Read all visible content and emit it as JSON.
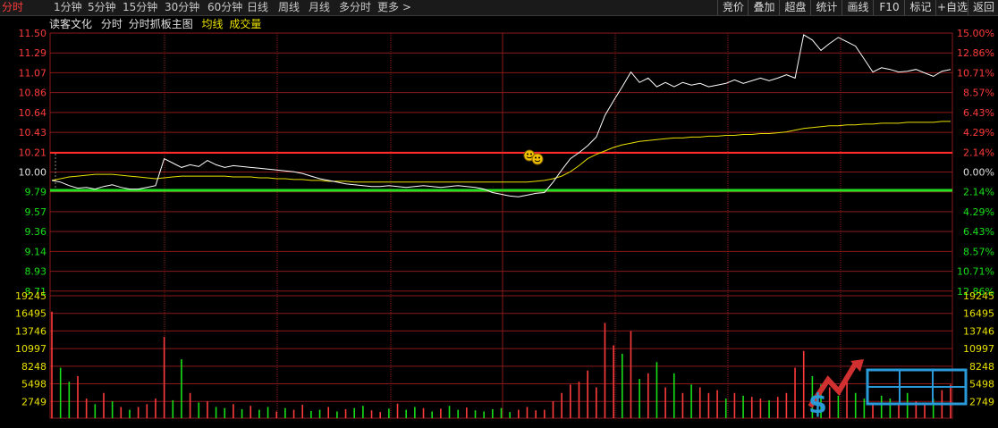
{
  "nav": {
    "tabs": [
      "分时",
      "1分钟",
      "5分钟",
      "15分钟",
      "30分钟",
      "60分钟",
      "日线",
      "周线",
      "月线",
      "多分时",
      "更多 >"
    ],
    "active_index": 0
  },
  "toolbar": [
    "竞价",
    "叠加",
    "超盘",
    "统计",
    "画线",
    "F10",
    "标记",
    "+自选",
    "返回"
  ],
  "info": {
    "stock_name": "读客文化",
    "view_mode": "分时",
    "board_label": "分时抓板主图",
    "avg_label": "均线",
    "volume_label": "成交量"
  },
  "colors": {
    "up": "#ff3b3b",
    "down": "#18e018",
    "flat": "#e0e0e0",
    "grid": "#8a1a1a",
    "price_line": "#ffffff",
    "avg_line": "#e8e000",
    "top_band": "#ff2a2a",
    "bottom_band": "#22e022"
  },
  "chart_data": {
    "type": "line",
    "prev_close": 10.0,
    "price_labels_left": [
      "11.50",
      "11.29",
      "11.07",
      "10.86",
      "10.64",
      "10.43",
      "10.21",
      "10.00",
      "9.79",
      "9.57",
      "9.36",
      "9.14",
      "8.93",
      "8.71"
    ],
    "pct_labels_right": [
      "15.00%",
      "12.86%",
      "10.71%",
      "8.57%",
      "6.43%",
      "4.29%",
      "2.14%",
      "0.00%",
      "2.14%",
      "4.29%",
      "6.43%",
      "8.57%",
      "10.71%",
      "12.86%"
    ],
    "ylim": [
      8.5,
      11.5
    ],
    "volume_labels": [
      "19245",
      "16495",
      "13746",
      "10997",
      "8248",
      "5498",
      "2749"
    ],
    "volume_max": 21995,
    "price_series": [
      9.8,
      9.78,
      9.74,
      9.71,
      9.72,
      9.7,
      9.73,
      9.75,
      9.72,
      9.7,
      9.7,
      9.72,
      9.74,
      10.05,
      10.0,
      9.95,
      9.98,
      9.96,
      10.03,
      9.98,
      9.95,
      9.97,
      9.96,
      9.95,
      9.94,
      9.93,
      9.92,
      9.91,
      9.9,
      9.88,
      9.85,
      9.82,
      9.8,
      9.78,
      9.76,
      9.75,
      9.74,
      9.73,
      9.73,
      9.74,
      9.73,
      9.72,
      9.73,
      9.74,
      9.73,
      9.72,
      9.73,
      9.74,
      9.73,
      9.72,
      9.7,
      9.66,
      9.64,
      9.62,
      9.61,
      9.63,
      9.65,
      9.66,
      9.78,
      9.92,
      10.05,
      10.12,
      10.2,
      10.3,
      10.55,
      10.72,
      10.88,
      11.05,
      10.93,
      10.98,
      10.88,
      10.93,
      10.88,
      10.93,
      10.9,
      10.92,
      10.88,
      10.9,
      10.92,
      10.96,
      10.92,
      10.95,
      10.98,
      10.95,
      10.98,
      11.02,
      10.98,
      11.48,
      11.42,
      11.3,
      11.38,
      11.45,
      11.4,
      11.35,
      11.2,
      11.05,
      11.1,
      11.08,
      11.05,
      11.06,
      11.08,
      11.04,
      11.0,
      11.06,
      11.08
    ],
    "avg_series": [
      9.8,
      9.82,
      9.84,
      9.85,
      9.86,
      9.87,
      9.87,
      9.87,
      9.86,
      9.85,
      9.84,
      9.83,
      9.82,
      9.83,
      9.84,
      9.85,
      9.85,
      9.85,
      9.85,
      9.85,
      9.85,
      9.84,
      9.84,
      9.84,
      9.83,
      9.83,
      9.82,
      9.82,
      9.81,
      9.81,
      9.8,
      9.8,
      9.79,
      9.79,
      9.79,
      9.78,
      9.78,
      9.78,
      9.78,
      9.78,
      9.78,
      9.78,
      9.78,
      9.78,
      9.78,
      9.78,
      9.78,
      9.78,
      9.78,
      9.78,
      9.78,
      9.78,
      9.78,
      9.78,
      9.78,
      9.78,
      9.79,
      9.8,
      9.82,
      9.85,
      9.9,
      9.97,
      10.05,
      10.1,
      10.14,
      10.18,
      10.21,
      10.23,
      10.25,
      10.26,
      10.27,
      10.28,
      10.29,
      10.29,
      10.3,
      10.3,
      10.31,
      10.31,
      10.32,
      10.32,
      10.33,
      10.33,
      10.34,
      10.34,
      10.35,
      10.36,
      10.38,
      10.4,
      10.41,
      10.42,
      10.43,
      10.43,
      10.44,
      10.44,
      10.45,
      10.45,
      10.46,
      10.46,
      10.46,
      10.47,
      10.47,
      10.47,
      10.47,
      10.48,
      10.48
    ],
    "volume_series": [
      19000,
      9000,
      6500,
      7500,
      3500,
      2500,
      4500,
      3000,
      2000,
      1500,
      2000,
      2500,
      3500,
      14500,
      3200,
      10500,
      4500,
      2800,
      3000,
      2000,
      1800,
      2500,
      1600,
      2200,
      1500,
      2000,
      1200,
      1800,
      1500,
      2400,
      1300,
      1500,
      2000,
      1200,
      1600,
      1800,
      2200,
      1400,
      1100,
      1700,
      2600,
      1500,
      2000,
      1800,
      1200,
      1700,
      2200,
      1500,
      1900,
      1400,
      1200,
      1600,
      1800,
      1100,
      1500,
      2000,
      1400,
      1500,
      3000,
      4500,
      6000,
      6500,
      8500,
      5500,
      17000,
      13000,
      11500,
      15500,
      7000,
      8000,
      10000,
      5500,
      8000,
      4500,
      6000,
      5500,
      4500,
      5000,
      3500,
      4500,
      4000,
      3800,
      3500,
      3200,
      3800,
      4500,
      9000,
      12000,
      7500,
      6000,
      5500,
      4000,
      7000,
      4500,
      3500,
      2800,
      4000,
      3500,
      2500,
      4500,
      3000,
      2800,
      3500,
      5000,
      6000
    ],
    "volume_dirs": [
      1,
      0,
      0,
      1,
      1,
      0,
      1,
      0,
      1,
      0,
      1,
      1,
      1,
      1,
      0,
      0,
      1,
      0,
      1,
      0,
      0,
      1,
      0,
      1,
      0,
      0,
      1,
      0,
      1,
      1,
      0,
      0,
      1,
      0,
      1,
      0,
      0,
      1,
      1,
      0,
      1,
      0,
      0,
      1,
      0,
      1,
      0,
      0,
      1,
      0,
      0,
      0,
      0,
      0,
      1,
      1,
      1,
      1,
      1,
      1,
      1,
      1,
      1,
      1,
      1,
      1,
      0,
      1,
      0,
      1,
      0,
      1,
      0,
      1,
      0,
      1,
      1,
      1,
      0,
      1,
      0,
      1,
      1,
      0,
      1,
      1,
      1,
      1,
      0,
      0,
      1,
      0,
      1,
      0,
      0,
      1,
      0,
      0,
      1,
      0,
      1,
      1,
      0,
      1,
      1
    ]
  }
}
